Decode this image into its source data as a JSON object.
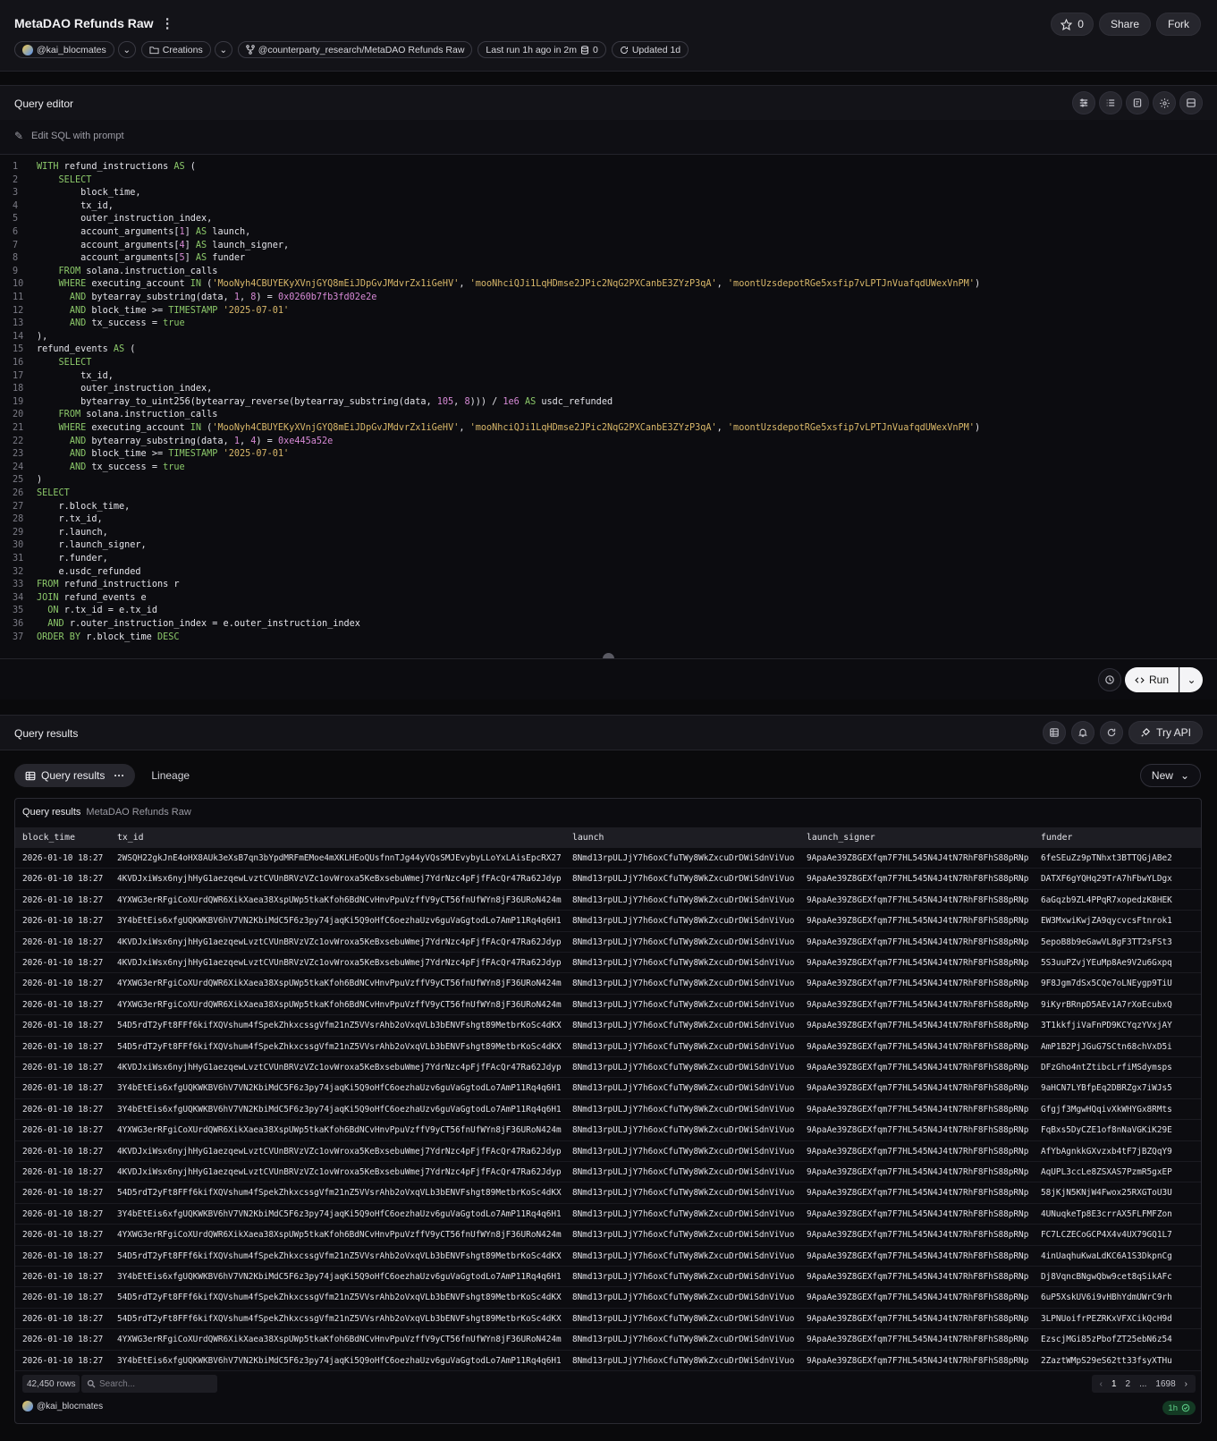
{
  "header": {
    "title": "MetaDAO Refunds Raw",
    "star_count": "0",
    "share_label": "Share",
    "fork_label": "Fork",
    "owner": "@kai_blocmates",
    "collection": "Creations",
    "repo_path": "@counterparty_research/MetaDAO Refunds Raw",
    "last_run": "Last run 1h ago in 2m",
    "credits": "0",
    "updated": "Updated 1d"
  },
  "editor": {
    "title": "Query editor",
    "prompt_placeholder": "Edit SQL with prompt",
    "lines": [
      [
        [
          "kw",
          "WITH"
        ],
        [
          "t",
          " refund_instructions "
        ],
        [
          "kw",
          "AS"
        ],
        [
          "t",
          " ("
        ]
      ],
      [
        [
          "t",
          "    "
        ],
        [
          "kw",
          "SELECT"
        ]
      ],
      [
        [
          "t",
          "        block_time,"
        ]
      ],
      [
        [
          "t",
          "        tx_id,"
        ]
      ],
      [
        [
          "t",
          "        outer_instruction_index,"
        ]
      ],
      [
        [
          "t",
          "        account_arguments["
        ],
        [
          "num",
          "1"
        ],
        [
          "t",
          "] "
        ],
        [
          "kw",
          "AS"
        ],
        [
          "t",
          " launch,"
        ]
      ],
      [
        [
          "t",
          "        account_arguments["
        ],
        [
          "num",
          "4"
        ],
        [
          "t",
          "] "
        ],
        [
          "kw",
          "AS"
        ],
        [
          "t",
          " launch_signer,"
        ]
      ],
      [
        [
          "t",
          "        account_arguments["
        ],
        [
          "num",
          "5"
        ],
        [
          "t",
          "] "
        ],
        [
          "kw",
          "AS"
        ],
        [
          "t",
          " funder"
        ]
      ],
      [
        [
          "t",
          "    "
        ],
        [
          "kw",
          "FROM"
        ],
        [
          "t",
          " solana.instruction_calls"
        ]
      ],
      [
        [
          "t",
          "    "
        ],
        [
          "kw",
          "WHERE"
        ],
        [
          "t",
          " executing_account "
        ],
        [
          "kw",
          "IN"
        ],
        [
          "t",
          " ("
        ],
        [
          "str",
          "'MooNyh4CBUYEKyXVnjGYQ8mEiJDpGvJMdvrZx1iGeHV'"
        ],
        [
          "t",
          ", "
        ],
        [
          "str",
          "'mooNhciQJi1LqHDmse2JPic2NqG2PXCanbE3ZYzP3qA'"
        ],
        [
          "t",
          ", "
        ],
        [
          "str",
          "'moontUzsdepotRGe5xsfip7vLPTJnVuafqdUWexVnPM'"
        ],
        [
          "t",
          ")"
        ]
      ],
      [
        [
          "t",
          "      "
        ],
        [
          "kw",
          "AND"
        ],
        [
          "t",
          " bytearray_substring(data, "
        ],
        [
          "num",
          "1"
        ],
        [
          "t",
          ", "
        ],
        [
          "num",
          "8"
        ],
        [
          "t",
          ") = "
        ],
        [
          "num",
          "0x0260b7fb3fd02e2e"
        ]
      ],
      [
        [
          "t",
          "      "
        ],
        [
          "kw",
          "AND"
        ],
        [
          "t",
          " block_time >= "
        ],
        [
          "kw",
          "TIMESTAMP"
        ],
        [
          "t",
          " "
        ],
        [
          "str",
          "'2025-07-01'"
        ]
      ],
      [
        [
          "t",
          "      "
        ],
        [
          "kw",
          "AND"
        ],
        [
          "t",
          " tx_success = "
        ],
        [
          "kw",
          "true"
        ]
      ],
      [
        [
          "t",
          "),"
        ]
      ],
      [
        [
          "t",
          "refund_events "
        ],
        [
          "kw",
          "AS"
        ],
        [
          "t",
          " ("
        ]
      ],
      [
        [
          "t",
          "    "
        ],
        [
          "kw",
          "SELECT"
        ]
      ],
      [
        [
          "t",
          "        tx_id,"
        ]
      ],
      [
        [
          "t",
          "        outer_instruction_index,"
        ]
      ],
      [
        [
          "t",
          "        bytearray_to_uint256(bytearray_reverse(bytearray_substring(data, "
        ],
        [
          "num",
          "105"
        ],
        [
          "t",
          ", "
        ],
        [
          "num",
          "8"
        ],
        [
          "t",
          "))) / "
        ],
        [
          "num",
          "1e6"
        ],
        [
          "t",
          " "
        ],
        [
          "kw",
          "AS"
        ],
        [
          "t",
          " usdc_refunded"
        ]
      ],
      [
        [
          "t",
          "    "
        ],
        [
          "kw",
          "FROM"
        ],
        [
          "t",
          " solana.instruction_calls"
        ]
      ],
      [
        [
          "t",
          "    "
        ],
        [
          "kw",
          "WHERE"
        ],
        [
          "t",
          " executing_account "
        ],
        [
          "kw",
          "IN"
        ],
        [
          "t",
          " ("
        ],
        [
          "str",
          "'MooNyh4CBUYEKyXVnjGYQ8mEiJDpGvJMdvrZx1iGeHV'"
        ],
        [
          "t",
          ", "
        ],
        [
          "str",
          "'mooNhciQJi1LqHDmse2JPic2NqG2PXCanbE3ZYzP3qA'"
        ],
        [
          "t",
          ", "
        ],
        [
          "str",
          "'moontUzsdepotRGe5xsfip7vLPTJnVuafqdUWexVnPM'"
        ],
        [
          "t",
          ")"
        ]
      ],
      [
        [
          "t",
          "      "
        ],
        [
          "kw",
          "AND"
        ],
        [
          "t",
          " bytearray_substring(data, "
        ],
        [
          "num",
          "1"
        ],
        [
          "t",
          ", "
        ],
        [
          "num",
          "4"
        ],
        [
          "t",
          ") = "
        ],
        [
          "num",
          "0xe445a52e"
        ]
      ],
      [
        [
          "t",
          "      "
        ],
        [
          "kw",
          "AND"
        ],
        [
          "t",
          " block_time >= "
        ],
        [
          "kw",
          "TIMESTAMP"
        ],
        [
          "t",
          " "
        ],
        [
          "str",
          "'2025-07-01'"
        ]
      ],
      [
        [
          "t",
          "      "
        ],
        [
          "kw",
          "AND"
        ],
        [
          "t",
          " tx_success = "
        ],
        [
          "kw",
          "true"
        ]
      ],
      [
        [
          "t",
          ")"
        ]
      ],
      [
        [
          "kw",
          "SELECT"
        ]
      ],
      [
        [
          "t",
          "    r.block_time,"
        ]
      ],
      [
        [
          "t",
          "    r.tx_id,"
        ]
      ],
      [
        [
          "t",
          "    r.launch,"
        ]
      ],
      [
        [
          "t",
          "    r.launch_signer,"
        ]
      ],
      [
        [
          "t",
          "    r.funder,"
        ]
      ],
      [
        [
          "t",
          "    e.usdc_refunded"
        ]
      ],
      [
        [
          "kw",
          "FROM"
        ],
        [
          "t",
          " refund_instructions r"
        ]
      ],
      [
        [
          "kw",
          "JOIN"
        ],
        [
          "t",
          " refund_events e"
        ]
      ],
      [
        [
          "t",
          "  "
        ],
        [
          "kw",
          "ON"
        ],
        [
          "t",
          " r.tx_id = e.tx_id"
        ]
      ],
      [
        [
          "t",
          "  "
        ],
        [
          "kw",
          "AND"
        ],
        [
          "t",
          " r.outer_instruction_index = e.outer_instruction_index"
        ]
      ],
      [
        [
          "kw",
          "ORDER BY"
        ],
        [
          "t",
          " r.block_time "
        ],
        [
          "kw",
          "DESC"
        ]
      ]
    ],
    "run_label": "Run"
  },
  "results": {
    "title": "Query results",
    "try_api_label": "Try API",
    "tab_results": "Query results",
    "tab_lineage": "Lineage",
    "new_label": "New",
    "table_title": "Query results",
    "table_subtitle": "MetaDAO Refunds Raw",
    "columns": [
      "block_time",
      "tx_id",
      "launch",
      "launch_signer",
      "funder"
    ],
    "rows": [
      [
        "2026-01-10 18:27",
        "2WSQH22gkJnE4oHX8AUk3eXsB7qn3bYpdMRFmEMoe4mXKLHEoQUsfnnTJg44yVQsSMJEvybyLLoYxLAisEpcRX27",
        "8Nmd13rpULJjY7h6oxCfuTWy8WkZxcuDrDWiSdnViVuo",
        "9ApaAe39Z8GEXfqm7F7HL545N4J4tN7RhF8FhS88pRNp",
        "6feSEuZz9pTNhxt3BTTQGjABe2"
      ],
      [
        "2026-01-10 18:27",
        "4KVDJxiWsx6nyjhHyG1aezqewLvztCVUnBRVzVZc1ovWroxa5KeBxsebuWmej7YdrNzc4pFjfFAcQr47Ra62Jdyp",
        "8Nmd13rpULJjY7h6oxCfuTWy8WkZxcuDrDWiSdnViVuo",
        "9ApaAe39Z8GEXfqm7F7HL545N4J4tN7RhF8FhS88pRNp",
        "DATXF6gYQHq29TrA7hFbwYLDgx"
      ],
      [
        "2026-01-10 18:27",
        "4YXWG3erRFgiCoXUrdQWR6XikXaea38XspUWp5tkaKfoh6BdNCvHnvPpuVzffV9yCT56fnUfWYn8jF36URoN424m",
        "8Nmd13rpULJjY7h6oxCfuTWy8WkZxcuDrDWiSdnViVuo",
        "9ApaAe39Z8GEXfqm7F7HL545N4J4tN7RhF8FhS88pRNp",
        "6aGqzb9ZL4PPqR7xopedzKBHEK"
      ],
      [
        "2026-01-10 18:27",
        "3Y4bEtEis6xfgUQKWKBV6hV7VN2KbiMdC5F6z3py74jaqKi5Q9oHfC6oezhaUzv6guVaGgtodLo7AmP11Rq4q6H1",
        "8Nmd13rpULJjY7h6oxCfuTWy8WkZxcuDrDWiSdnViVuo",
        "9ApaAe39Z8GEXfqm7F7HL545N4J4tN7RhF8FhS88pRNp",
        "EW3MxwiKwjZA9qycvcsFtnrok1"
      ],
      [
        "2026-01-10 18:27",
        "4KVDJxiWsx6nyjhHyG1aezqewLvztCVUnBRVzVZc1ovWroxa5KeBxsebuWmej7YdrNzc4pFjfFAcQr47Ra62Jdyp",
        "8Nmd13rpULJjY7h6oxCfuTWy8WkZxcuDrDWiSdnViVuo",
        "9ApaAe39Z8GEXfqm7F7HL545N4J4tN7RhF8FhS88pRNp",
        "5epoB8b9eGawVL8gF3TT2sFSt3"
      ],
      [
        "2026-01-10 18:27",
        "4KVDJxiWsx6nyjhHyG1aezqewLvztCVUnBRVzVZc1ovWroxa5KeBxsebuWmej7YdrNzc4pFjfFAcQr47Ra62Jdyp",
        "8Nmd13rpULJjY7h6oxCfuTWy8WkZxcuDrDWiSdnViVuo",
        "9ApaAe39Z8GEXfqm7F7HL545N4J4tN7RhF8FhS88pRNp",
        "5S3uuPZvjYEuMp8Ae9V2u6Gxpq"
      ],
      [
        "2026-01-10 18:27",
        "4YXWG3erRFgiCoXUrdQWR6XikXaea38XspUWp5tkaKfoh6BdNCvHnvPpuVzffV9yCT56fnUfWYn8jF36URoN424m",
        "8Nmd13rpULJjY7h6oxCfuTWy8WkZxcuDrDWiSdnViVuo",
        "9ApaAe39Z8GEXfqm7F7HL545N4J4tN7RhF8FhS88pRNp",
        "9F8Jgm7dSx5CQe7oLNEygp9TiU"
      ],
      [
        "2026-01-10 18:27",
        "4YXWG3erRFgiCoXUrdQWR6XikXaea38XspUWp5tkaKfoh6BdNCvHnvPpuVzffV9yCT56fnUfWYn8jF36URoN424m",
        "8Nmd13rpULJjY7h6oxCfuTWy8WkZxcuDrDWiSdnViVuo",
        "9ApaAe39Z8GEXfqm7F7HL545N4J4tN7RhF8FhS88pRNp",
        "9iKyrBRnpD5AEv1A7rXoEcubxQ"
      ],
      [
        "2026-01-10 18:27",
        "54D5rdT2yFt8FFf6kifXQVshum4fSpekZhkxcssgVfm21nZ5VVsrAhb2oVxqVLb3bENVFshgt89MetbrKoSc4dKX",
        "8Nmd13rpULJjY7h6oxCfuTWy8WkZxcuDrDWiSdnViVuo",
        "9ApaAe39Z8GEXfqm7F7HL545N4J4tN7RhF8FhS88pRNp",
        "3T1kkfjiVaFnPD9KCYqzYVxjAY"
      ],
      [
        "2026-01-10 18:27",
        "54D5rdT2yFt8FFf6kifXQVshum4fSpekZhkxcssgVfm21nZ5VVsrAhb2oVxqVLb3bENVFshgt89MetbrKoSc4dKX",
        "8Nmd13rpULJjY7h6oxCfuTWy8WkZxcuDrDWiSdnViVuo",
        "9ApaAe39Z8GEXfqm7F7HL545N4J4tN7RhF8FhS88pRNp",
        "AmP1B2PjJGuG7SCtn68chVxD5i"
      ],
      [
        "2026-01-10 18:27",
        "4KVDJxiWsx6nyjhHyG1aezqewLvztCVUnBRVzVZc1ovWroxa5KeBxsebuWmej7YdrNzc4pFjfFAcQr47Ra62Jdyp",
        "8Nmd13rpULJjY7h6oxCfuTWy8WkZxcuDrDWiSdnViVuo",
        "9ApaAe39Z8GEXfqm7F7HL545N4J4tN7RhF8FhS88pRNp",
        "DFzGho4ntZtibcLrfiMSdymsps"
      ],
      [
        "2026-01-10 18:27",
        "3Y4bEtEis6xfgUQKWKBV6hV7VN2KbiMdC5F6z3py74jaqKi5Q9oHfC6oezhaUzv6guVaGgtodLo7AmP11Rq4q6H1",
        "8Nmd13rpULJjY7h6oxCfuTWy8WkZxcuDrDWiSdnViVuo",
        "9ApaAe39Z8GEXfqm7F7HL545N4J4tN7RhF8FhS88pRNp",
        "9aHCN7LYBfpEq2DBRZgx7iWJs5"
      ],
      [
        "2026-01-10 18:27",
        "3Y4bEtEis6xfgUQKWKBV6hV7VN2KbiMdC5F6z3py74jaqKi5Q9oHfC6oezhaUzv6guVaGgtodLo7AmP11Rq4q6H1",
        "8Nmd13rpULJjY7h6oxCfuTWy8WkZxcuDrDWiSdnViVuo",
        "9ApaAe39Z8GEXfqm7F7HL545N4J4tN7RhF8FhS88pRNp",
        "Gfgjf3MgwHQqivXkWHYGx8RMts"
      ],
      [
        "2026-01-10 18:27",
        "4YXWG3erRFgiCoXUrdQWR6XikXaea38XspUWp5tkaKfoh6BdNCvHnvPpuVzffV9yCT56fnUfWYn8jF36URoN424m",
        "8Nmd13rpULJjY7h6oxCfuTWy8WkZxcuDrDWiSdnViVuo",
        "9ApaAe39Z8GEXfqm7F7HL545N4J4tN7RhF8FhS88pRNp",
        "FqBxs5DyCZE1of8nNaVGKiK29E"
      ],
      [
        "2026-01-10 18:27",
        "4KVDJxiWsx6nyjhHyG1aezqewLvztCVUnBRVzVZc1ovWroxa5KeBxsebuWmej7YdrNzc4pFjfFAcQr47Ra62Jdyp",
        "8Nmd13rpULJjY7h6oxCfuTWy8WkZxcuDrDWiSdnViVuo",
        "9ApaAe39Z8GEXfqm7F7HL545N4J4tN7RhF8FhS88pRNp",
        "AfYbAgnkkGXvzxb4tF7jBZQqY9"
      ],
      [
        "2026-01-10 18:27",
        "4KVDJxiWsx6nyjhHyG1aezqewLvztCVUnBRVzVZc1ovWroxa5KeBxsebuWmej7YdrNzc4pFjfFAcQr47Ra62Jdyp",
        "8Nmd13rpULJjY7h6oxCfuTWy8WkZxcuDrDWiSdnViVuo",
        "9ApaAe39Z8GEXfqm7F7HL545N4J4tN7RhF8FhS88pRNp",
        "AqUPL3ccLe8ZSXAS7PzmR5gxEP"
      ],
      [
        "2026-01-10 18:27",
        "54D5rdT2yFt8FFf6kifXQVshum4fSpekZhkxcssgVfm21nZ5VVsrAhb2oVxqVLb3bENVFshgt89MetbrKoSc4dKX",
        "8Nmd13rpULJjY7h6oxCfuTWy8WkZxcuDrDWiSdnViVuo",
        "9ApaAe39Z8GEXfqm7F7HL545N4J4tN7RhF8FhS88pRNp",
        "58jKjN5KNjW4Fwox25RXGToU3U"
      ],
      [
        "2026-01-10 18:27",
        "3Y4bEtEis6xfgUQKWKBV6hV7VN2KbiMdC5F6z3py74jaqKi5Q9oHfC6oezhaUzv6guVaGgtodLo7AmP11Rq4q6H1",
        "8Nmd13rpULJjY7h6oxCfuTWy8WkZxcuDrDWiSdnViVuo",
        "9ApaAe39Z8GEXfqm7F7HL545N4J4tN7RhF8FhS88pRNp",
        "4UNuqkeTp8E3crrAX5FLFMFZon"
      ],
      [
        "2026-01-10 18:27",
        "4YXWG3erRFgiCoXUrdQWR6XikXaea38XspUWp5tkaKfoh6BdNCvHnvPpuVzffV9yCT56fnUfWYn8jF36URoN424m",
        "8Nmd13rpULJjY7h6oxCfuTWy8WkZxcuDrDWiSdnViVuo",
        "9ApaAe39Z8GEXfqm7F7HL545N4J4tN7RhF8FhS88pRNp",
        "FC7LCZECoGCP4X4v4UX79GQ1L7"
      ],
      [
        "2026-01-10 18:27",
        "54D5rdT2yFt8FFf6kifXQVshum4fSpekZhkxcssgVfm21nZ5VVsrAhb2oVxqVLb3bENVFshgt89MetbrKoSc4dKX",
        "8Nmd13rpULJjY7h6oxCfuTWy8WkZxcuDrDWiSdnViVuo",
        "9ApaAe39Z8GEXfqm7F7HL545N4J4tN7RhF8FhS88pRNp",
        "4inUaqhuKwaLdKC6A1S3DkpnCg"
      ],
      [
        "2026-01-10 18:27",
        "3Y4bEtEis6xfgUQKWKBV6hV7VN2KbiMdC5F6z3py74jaqKi5Q9oHfC6oezhaUzv6guVaGgtodLo7AmP11Rq4q6H1",
        "8Nmd13rpULJjY7h6oxCfuTWy8WkZxcuDrDWiSdnViVuo",
        "9ApaAe39Z8GEXfqm7F7HL545N4J4tN7RhF8FhS88pRNp",
        "Dj8VqncBNgwQbw9cet8qSikAFc"
      ],
      [
        "2026-01-10 18:27",
        "54D5rdT2yFt8FFf6kifXQVshum4fSpekZhkxcssgVfm21nZ5VVsrAhb2oVxqVLb3bENVFshgt89MetbrKoSc4dKX",
        "8Nmd13rpULJjY7h6oxCfuTWy8WkZxcuDrDWiSdnViVuo",
        "9ApaAe39Z8GEXfqm7F7HL545N4J4tN7RhF8FhS88pRNp",
        "6uP5XskUV6i9vHBhYdmUWrC9rh"
      ],
      [
        "2026-01-10 18:27",
        "54D5rdT2yFt8FFf6kifXQVshum4fSpekZhkxcssgVfm21nZ5VVsrAhb2oVxqVLb3bENVFshgt89MetbrKoSc4dKX",
        "8Nmd13rpULJjY7h6oxCfuTWy8WkZxcuDrDWiSdnViVuo",
        "9ApaAe39Z8GEXfqm7F7HL545N4J4tN7RhF8FhS88pRNp",
        "3LPNUoifrPEZRKxVFXCikQcH9d"
      ],
      [
        "2026-01-10 18:27",
        "4YXWG3erRFgiCoXUrdQWR6XikXaea38XspUWp5tkaKfoh6BdNCvHnvPpuVzffV9yCT56fnUfWYn8jF36URoN424m",
        "8Nmd13rpULJjY7h6oxCfuTWy8WkZxcuDrDWiSdnViVuo",
        "9ApaAe39Z8GEXfqm7F7HL545N4J4tN7RhF8FhS88pRNp",
        "EzscjMGi85zPbofZT25ebN6z54"
      ],
      [
        "2026-01-10 18:27",
        "3Y4bEtEis6xfgUQKWKBV6hV7VN2KbiMdC5F6z3py74jaqKi5Q9oHfC6oezhaUzv6guVaGgtodLo7AmP11Rq4q6H1",
        "8Nmd13rpULJjY7h6oxCfuTWy8WkZxcuDrDWiSdnViVuo",
        "9ApaAe39Z8GEXfqm7F7HL545N4J4tN7RhF8FhS88pRNp",
        "2ZaztWMpS29eS62tt33fsyXTHu"
      ]
    ],
    "row_count": "42,450 rows",
    "search_placeholder": "Search...",
    "pager": {
      "prev": "‹",
      "p1": "1",
      "p2": "2",
      "ellipsis": "...",
      "last": "1698",
      "next": "›"
    },
    "owner": "@kai_blocmates",
    "freshness": "1h"
  },
  "colors": {
    "keyword": "#8cc96a",
    "string": "#d9b86a",
    "number": "#d78ad6",
    "success": "#5fd38a"
  }
}
